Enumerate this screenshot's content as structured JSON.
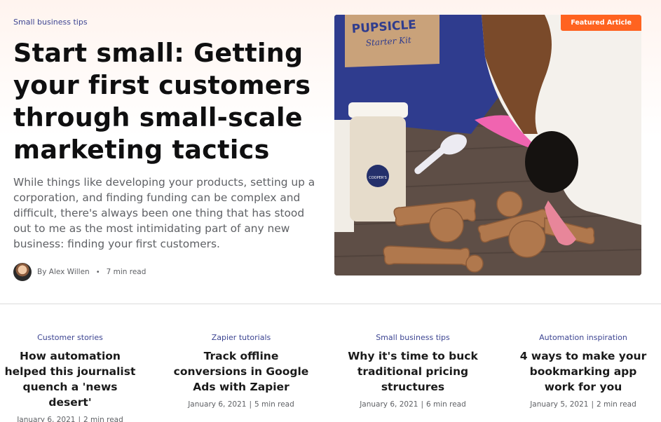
{
  "hero": {
    "category": "Small business tips",
    "title": "Start small: Getting your first customers through small-scale marketing tactics",
    "description": "While things like developing your products, setting up a corporation, and finding funding can be complex and difficult, there's always been one thing that has stood out to me as the most intimidating part of any new business: finding your first customers.",
    "author": "By Alex Willen",
    "read_time": "7 min read",
    "badge": "Featured Article",
    "image_text": {
      "box_title": "PUPSICLE",
      "box_subtitle": "Starter Kit",
      "jar_brand": "COOPER'S"
    }
  },
  "cards": [
    {
      "category": "Customer stories",
      "title": "How automation helped this journalist quench a 'news desert'",
      "date": "January 6, 2021",
      "read_time": "2 min read"
    },
    {
      "category": "Zapier tutorials",
      "title": "Track offline conversions in Google Ads with Zapier",
      "date": "January 6, 2021",
      "read_time": "5 min read"
    },
    {
      "category": "Small business tips",
      "title": "Why it's time to buck traditional pricing structures",
      "date": "January 6, 2021",
      "read_time": "6 min read"
    },
    {
      "category": "Automation inspiration",
      "title": "4 ways to make your bookmarking app work for you",
      "date": "January 5, 2021",
      "read_time": "2 min read"
    }
  ],
  "colors": {
    "accent": "#ff6320",
    "link": "#3d4592"
  }
}
